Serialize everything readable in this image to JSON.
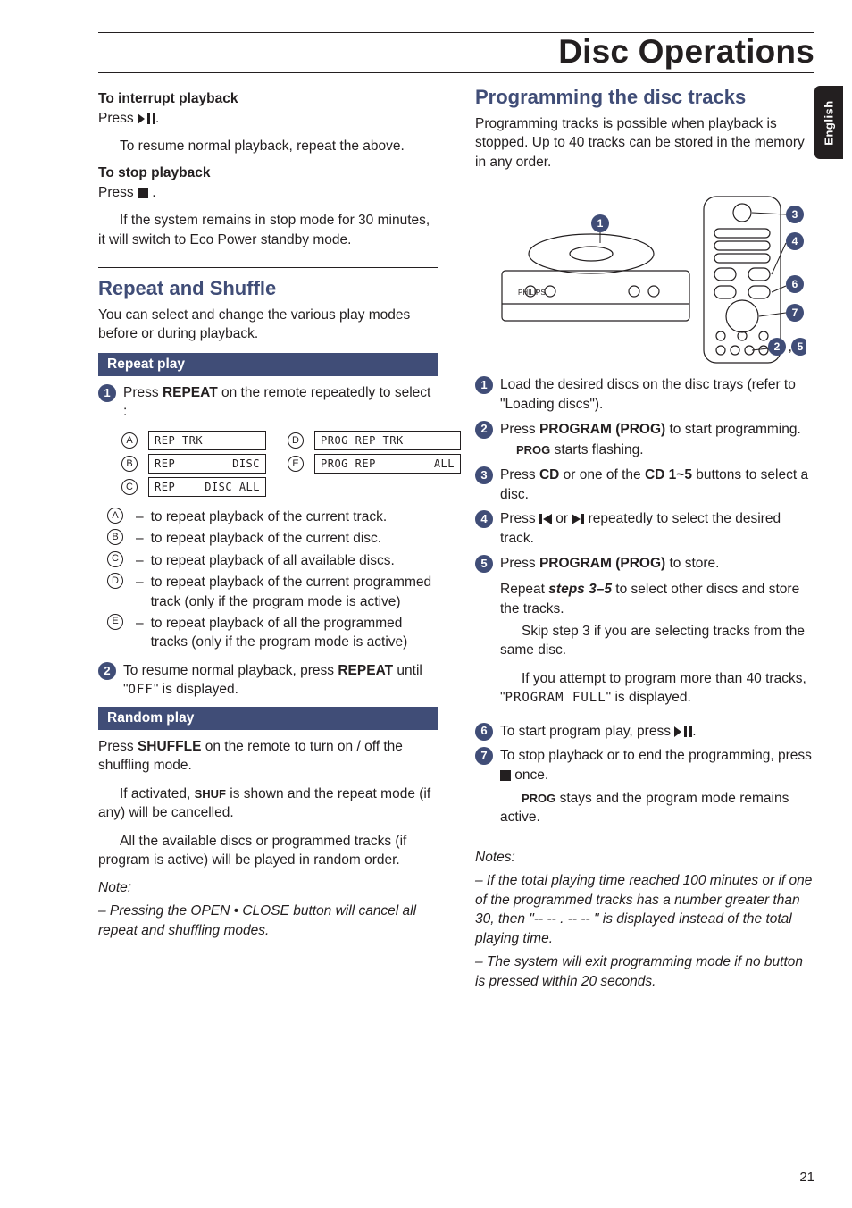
{
  "page": {
    "title": "Disc Operations",
    "lang_tab": "English",
    "number": "21"
  },
  "left": {
    "interrupt_h": "To interrupt playback",
    "interrupt_press": "Press  ",
    "interrupt_tail": ".",
    "interrupt_p2": "To resume normal playback, repeat the above.",
    "stop_h": "To stop playback",
    "stop_press": "Press  ",
    "stop_tail": " .",
    "stop_p2": "If the system remains in stop mode for 30 minutes, it will switch to Eco Power standby mode.",
    "rs_h": "Repeat and Shuffle",
    "rs_intro": "You can select and change the various play modes before or during playback.",
    "repeat_bar": "Repeat play",
    "repeat_step1_a": "Press ",
    "repeat_step1_b": "REPEAT",
    "repeat_step1_c": " on the remote repeatedly to select :",
    "disp": {
      "A": "REP TRK",
      "B_l": "REP",
      "B_r": "DISC",
      "C_l": "REP",
      "C_r": "DISC ALL",
      "D": "PROG  REP TRK",
      "E_l": "PROG  REP",
      "E_r": "ALL"
    },
    "opts": {
      "A": "to repeat playback of the current track.",
      "B": "to repeat playback of the current disc.",
      "C": "to repeat playback of all available discs.",
      "D": "to repeat playback of the current programmed track (only if the program mode is active)",
      "E": "to repeat playback of all the programmed tracks (only if the program mode is active)"
    },
    "repeat_step2_a": "To resume normal playback, press ",
    "repeat_step2_b": "REPEAT",
    "repeat_step2_c": " until \"",
    "repeat_step2_seg": "OFF",
    "repeat_step2_d": "\" is displayed.",
    "random_bar": "Random play",
    "random_p1_a": "Press ",
    "random_p1_b": "SHUFFLE",
    "random_p1_c": " on the remote to turn on / off the shuffling mode.",
    "random_p2_a": "If activated, ",
    "random_p2_sc": "SHUF",
    "random_p2_b": " is shown and the repeat mode (if any) will be cancelled.",
    "random_p3": "All the available discs or programmed tracks (if program is active) will be played in random order.",
    "note_h": "Note:",
    "note_1": "–   Pressing the OPEN • CLOSE button will cancel all repeat and shuffling modes."
  },
  "right": {
    "prog_h": "Programming the disc tracks",
    "prog_intro": "Programming tracks is possible when playback is stopped. Up to 40 tracks can be stored in the memory in any order.",
    "s1_a": "Load the desired discs on the disc trays (refer to \"",
    "s1_b": "Loading discs",
    "s1_c": "\").",
    "s2_a": "Press ",
    "s2_b": "PROGRAM (PROG)",
    "s2_c": " to start programming.",
    "s2_sub_sc": "PROG",
    "s2_sub": " starts flashing.",
    "s3_a": "Press ",
    "s3_b": "CD",
    "s3_c": " or one of the ",
    "s3_d": "CD 1~5",
    "s3_e": " buttons to select a disc.",
    "s4_a": "Press  ",
    "s4_b": "  or  ",
    "s4_c": "  repeatedly to select the desired track.",
    "s5_a": "Press ",
    "s5_b": "PROGRAM (PROG)",
    "s5_c": " to store.",
    "s5_p2_a": "Repeat ",
    "s5_p2_b": "steps 3–5",
    "s5_p2_c": " to select other discs and store the tracks.",
    "s5_p3": "Skip step 3 if you are selecting tracks from the same disc.",
    "s5_p4_a": "If you attempt to program more than 40 tracks, \"",
    "s5_p4_seg": "PROGRAM  FULL",
    "s5_p4_b": "\" is displayed.",
    "s6_a": "To start program play, press  ",
    "s6_b": ".",
    "s7_a": "To stop playback or to end the programming, press  ",
    "s7_b": "  once.",
    "s7_sub_sc": "PROG",
    "s7_sub": " stays and the program mode remains active.",
    "notes_h": "Notes:",
    "note_1": "–   If the total playing time reached 100 minutes or if one of the programmed tracks has a number greater than 30, then \"-- -- . -- -- \" is displayed instead of the total playing time.",
    "note_2": "–   The system will exit programming mode if no button is pressed within 20 seconds."
  }
}
